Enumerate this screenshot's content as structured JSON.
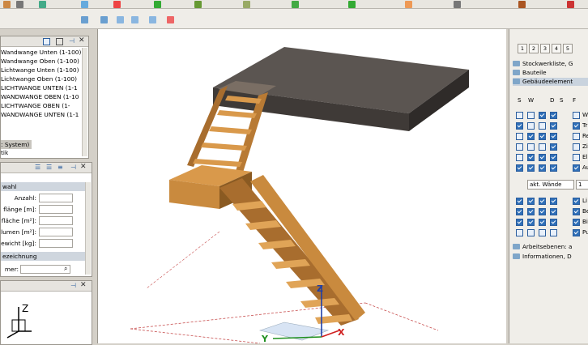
{
  "object_tree": {
    "items": [
      "Wandwange Unten (1-100)",
      "Wandwange Oben (1-100)",
      "Lichtwange Unten (1-100)",
      "Lichtwange Oben (1-100)",
      "LICHTWANGE UNTEN (1-1",
      "WANDWANGE OBEN (1-10",
      "LICHTWANGE OBEN (1-",
      "WANDWANGE UNTEN (1-1"
    ],
    "selected": ": System)",
    "extra": "tik"
  },
  "properties": {
    "header": "wahl",
    "fields": [
      {
        "label": "Anzahl:",
        "value": ""
      },
      {
        "label": "flänge [m]:",
        "value": ""
      },
      {
        "label": "fläche [m²]:",
        "value": ""
      },
      {
        "label": "lumen [m²]:",
        "value": ""
      },
      {
        "label": "ewicht [kg]:",
        "value": ""
      }
    ],
    "section2": "ezeichnung",
    "field2_label": "mer:",
    "field2_value": ""
  },
  "right_panel": {
    "tabs": [
      "1",
      "2",
      "3",
      "4",
      "5"
    ],
    "tree": [
      "Stockwerkliste, G",
      "Bauteile",
      "Gebäudeelement"
    ],
    "columns": [
      "S",
      "W",
      "D",
      "S",
      "F"
    ],
    "rows": [
      {
        "label": "W",
        "checks": [
          false,
          false,
          true,
          true,
          false
        ]
      },
      {
        "label": "Tr",
        "checks": [
          true,
          false,
          false,
          true,
          true
        ]
      },
      {
        "label": "Re",
        "checks": [
          false,
          true,
          true,
          true,
          false
        ]
      },
      {
        "label": "Zi",
        "checks": [
          false,
          false,
          false,
          true,
          false
        ]
      },
      {
        "label": "El",
        "checks": [
          false,
          true,
          true,
          true,
          false
        ]
      },
      {
        "label": "Au",
        "checks": [
          true,
          true,
          true,
          true,
          true
        ]
      }
    ],
    "dropdown_value": "akt. Wände",
    "dropdown2_value": "1",
    "rows2": [
      {
        "label": "Li",
        "checks": [
          true,
          true,
          true,
          true,
          true
        ]
      },
      {
        "label": "Be",
        "checks": [
          true,
          true,
          true,
          true,
          true
        ]
      },
      {
        "label": "Bi",
        "checks": [
          true,
          true,
          true,
          true,
          true
        ]
      },
      {
        "label": "Pu",
        "checks": [
          false,
          false,
          false,
          false,
          true
        ]
      }
    ],
    "bottom": [
      "Arbeitsebenen: a",
      "Informationen, D"
    ]
  },
  "axes": {
    "z": "Z",
    "x": "X",
    "y": "Y"
  },
  "colors": {
    "slab_top": "#5b5551",
    "slab_front": "#3f3a37",
    "wood": "#c98a3e",
    "wood_dark": "#8a5a22",
    "selection_blue": "#2f6fb8"
  }
}
